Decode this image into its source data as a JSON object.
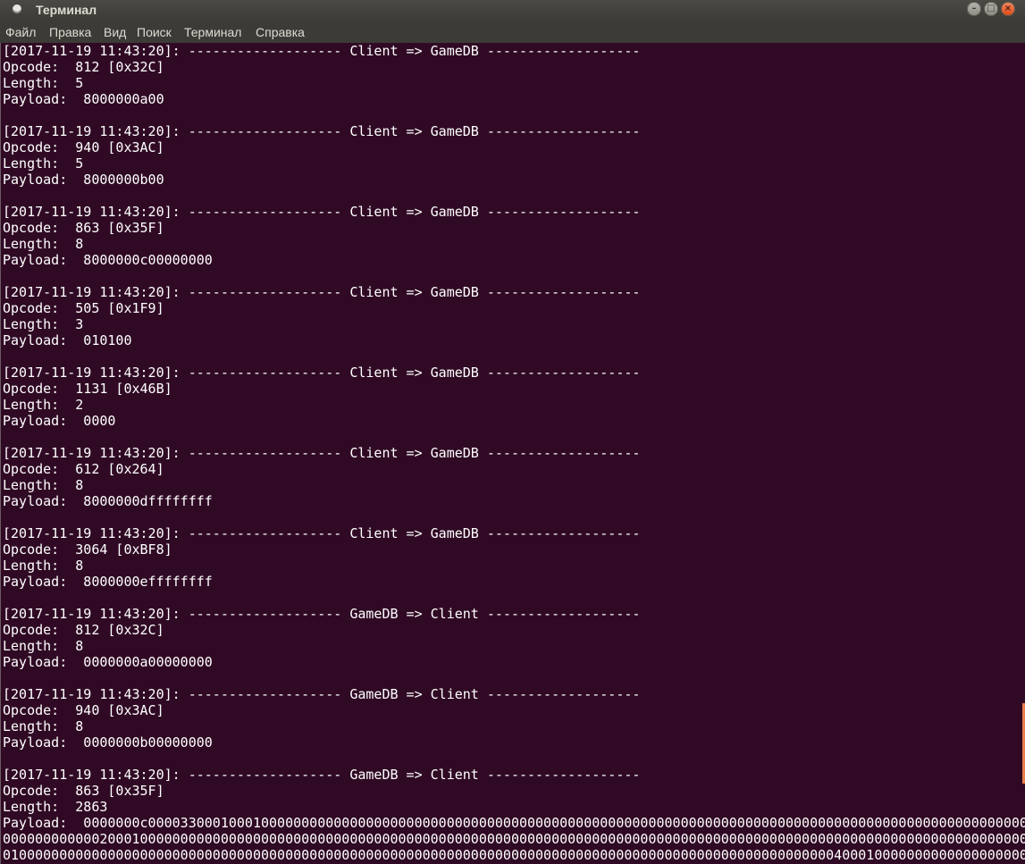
{
  "window": {
    "title": "Терминал",
    "buttons": {
      "minimize": "–",
      "maximize": "□",
      "close": "×"
    },
    "colors": {
      "terminal_background": "#300a24",
      "text": "#ffffff",
      "titlebar": "#3c3b37",
      "close_button": "#dd4814"
    }
  },
  "menu": {
    "items": [
      "Файл",
      "Правка",
      "Вид",
      "Поиск",
      "Терминал",
      "Справка"
    ]
  },
  "terminal": {
    "lines": [
      "[2017-11-19 11:43:20]: ------------------- Client => GameDB -------------------",
      "Opcode:  812 [0x32C]",
      "Length:  5",
      "Payload:  8000000a00",
      "",
      "[2017-11-19 11:43:20]: ------------------- Client => GameDB -------------------",
      "Opcode:  940 [0x3AC]",
      "Length:  5",
      "Payload:  8000000b00",
      "",
      "[2017-11-19 11:43:20]: ------------------- Client => GameDB -------------------",
      "Opcode:  863 [0x35F]",
      "Length:  8",
      "Payload:  8000000c00000000",
      "",
      "[2017-11-19 11:43:20]: ------------------- Client => GameDB -------------------",
      "Opcode:  505 [0x1F9]",
      "Length:  3",
      "Payload:  010100",
      "",
      "[2017-11-19 11:43:20]: ------------------- Client => GameDB -------------------",
      "Opcode:  1131 [0x46B]",
      "Length:  2",
      "Payload:  0000",
      "",
      "[2017-11-19 11:43:20]: ------------------- Client => GameDB -------------------",
      "Opcode:  612 [0x264]",
      "Length:  8",
      "Payload:  8000000dffffffff",
      "",
      "[2017-11-19 11:43:20]: ------------------- Client => GameDB -------------------",
      "Opcode:  3064 [0xBF8]",
      "Length:  8",
      "Payload:  8000000effffffff",
      "",
      "[2017-11-19 11:43:20]: ------------------- GameDB => Client -------------------",
      "Opcode:  812 [0x32C]",
      "Length:  8",
      "Payload:  0000000a00000000",
      "",
      "[2017-11-19 11:43:20]: ------------------- GameDB => Client -------------------",
      "Opcode:  940 [0x3AC]",
      "Length:  8",
      "Payload:  0000000b00000000",
      "",
      "[2017-11-19 11:43:20]: ------------------- GameDB => Client -------------------",
      "Opcode:  863 [0x35F]",
      "Length:  2863",
      "Payload:  0000000c000033000100010000000000000000000000000000000000000000000000000000000000000000000000000000000000000000000000000000000000000",
      "00000000000020001000000000000000000000000000000000000000000000000000000000000000000000000000000000000000000000000000000000000003000",
      "01000000000000000000000000000000000000000000000000000000000000000000000000000000000000000000000000000004000100000000000000000000000"
    ]
  }
}
